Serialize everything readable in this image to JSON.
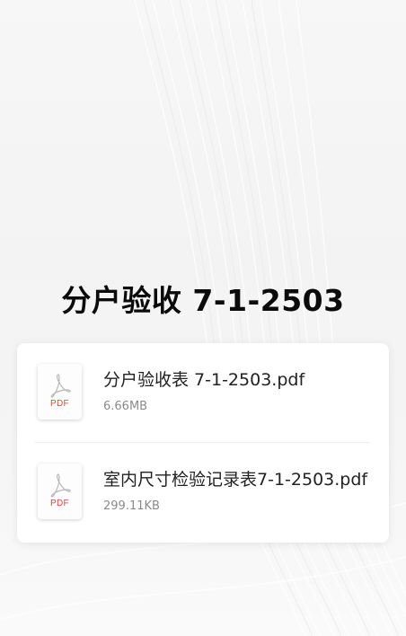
{
  "title": "分户验收 7-1-2503",
  "files": [
    {
      "name": "分户验收表 7-1-2503.pdf",
      "size": "6.66MB",
      "icon": "pdf-icon",
      "icon_label": "PDF"
    },
    {
      "name": "室内尺寸检验记录表7-1-2503.pdf",
      "size": "299.11KB",
      "icon": "pdf-icon",
      "icon_label": "PDF"
    }
  ],
  "colors": {
    "pdf_accent": "#d9473a",
    "title": "#0b0b0b",
    "card": "#ffffff"
  }
}
